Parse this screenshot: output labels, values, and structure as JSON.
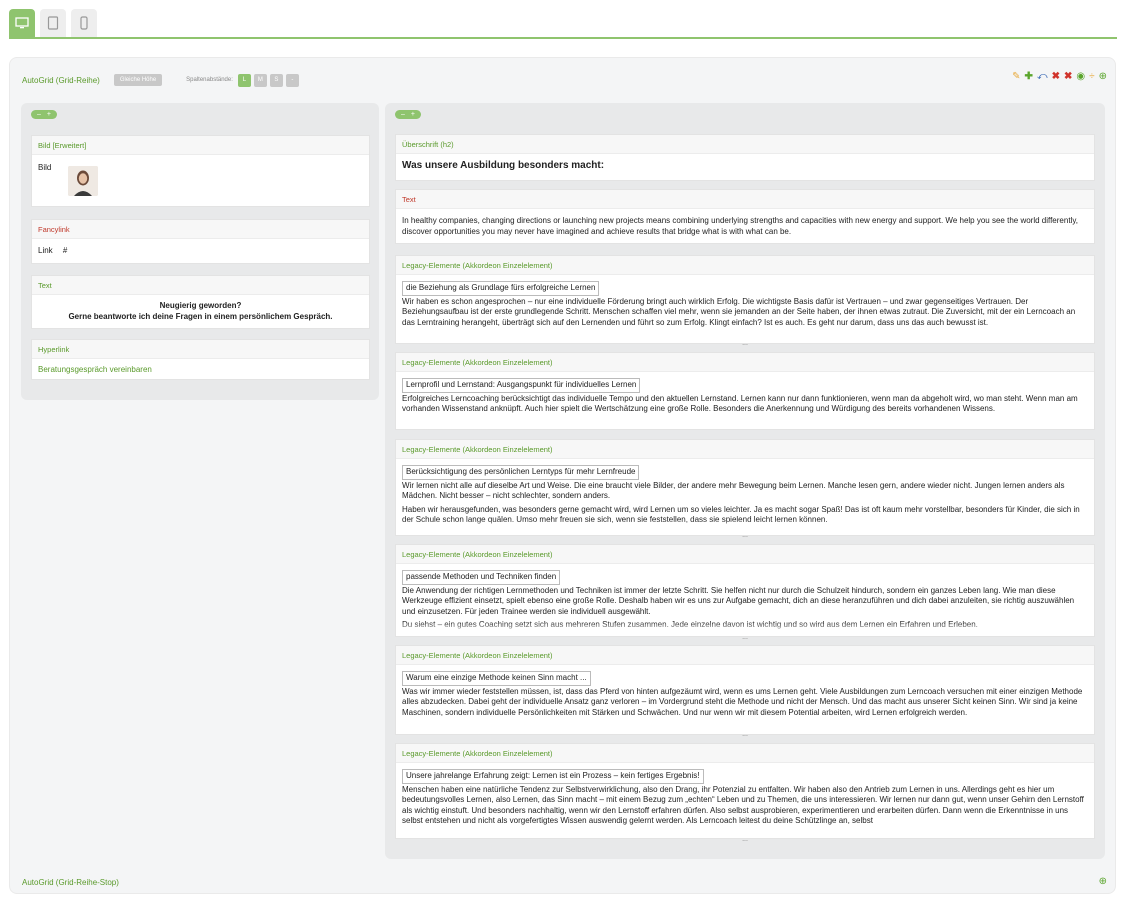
{
  "autogrid": {
    "title": "AutoGrid (Grid-Reihe)",
    "equal_height_label": "Gleiche Höhe",
    "spacing_label": "Spaltenabstände:",
    "spacing_options": [
      "L",
      "M",
      "S",
      "-"
    ],
    "footer_title": "AutoGrid (Grid-Reihe-Stop)"
  },
  "icons": {
    "desktop": "desktop-icon",
    "tablet": "tablet-icon",
    "phone": "phone-icon",
    "edit": "pencil-icon",
    "add": "plus-icon",
    "move": "move-icon",
    "delete": "x-icon",
    "delete_all": "x-icon",
    "view": "eye-icon",
    "split": "split-icon",
    "add_circle": "plus-circle-icon"
  },
  "colors": {
    "accent": "#8fc46e",
    "label_green": "#5a9a2b",
    "label_red": "#c0392b"
  },
  "left": {
    "image": {
      "title": "Bild [Erweitert]",
      "label": "Bild"
    },
    "fancylink": {
      "title": "Fancylink",
      "label": "Link",
      "value": "#"
    },
    "text": {
      "title": "Text",
      "line1": "Neugierig geworden?",
      "line2": "Gerne beantworte ich deine Fragen in einem persönlichem Gespräch."
    },
    "hyperlink": {
      "title": "Hyperlink",
      "link_text": "Beratungsgespräch vereinbaren"
    }
  },
  "right": {
    "heading": {
      "title": "Überschrift (h2)",
      "text": "Was unsere Ausbildung besonders macht:"
    },
    "text": {
      "title": "Text",
      "body": "In healthy companies, changing directions or launching new projects means combining underlying strengths and capacities with new energy and support. We help you see the world differently, discover opportunities you may never have imagined and achieve results that bridge what is with what can be."
    },
    "accordion_title": "Legacy-Elemente (Akkordeon Einzelelement)",
    "ellipsis": "...",
    "accordions": [
      {
        "heading": "die Beziehung als Grundlage fürs erfolgreiche Lernen",
        "body": "Wir haben es schon angesprochen – nur eine individuelle Förderung bringt auch wirklich Erfolg. Die wichtigste Basis dafür ist Vertrauen – und zwar gegenseitiges Vertrauen. Der Beziehungsaufbau ist der erste grundlegende Schritt. Menschen schaffen viel mehr, wenn sie jemanden an der Seite haben, der ihnen etwas zutraut. Die Zuversicht, mit der ein Lerncoach an das Lerntraining herangeht, überträgt sich auf den Lernenden und führt so zum Erfolg. Klingt einfach? Ist es auch. Es geht nur darum, dass uns das auch bewusst ist.",
        "body2": ""
      },
      {
        "heading": "Lernprofil und Lernstand: Ausgangspunkt für individuelles Lernen",
        "body": "Erfolgreiches Lerncoaching berücksichtigt das individuelle Tempo und den aktuellen Lernstand. Lernen kann nur dann funktionieren, wenn man da abgeholt wird, wo man steht. Wenn man am vorhanden Wissenstand anknüpft. Auch hier spielt die Wertschätzung eine große Rolle. Besonders die Anerkennung und Würdigung des bereits vorhandenen Wissens.",
        "body2": ""
      },
      {
        "heading": "Berücksichtigung des persönlichen Lerntyps für mehr Lernfreude",
        "body": "Wir lernen nicht alle auf dieselbe Art und Weise. Die eine braucht viele Bilder, der andere mehr Bewegung beim Lernen. Manche lesen gern, andere wieder nicht. Jungen lernen anders als Mädchen. Nicht besser – nicht schlechter, sondern anders.",
        "body2": "Haben wir herausgefunden, was besonders gerne gemacht wird, wird Lernen um so vieles leichter. Ja es macht sogar Spaß! Das ist oft kaum mehr vorstellbar, besonders für Kinder, die sich in der Schule schon lange quälen. Umso mehr freuen sie sich, wenn sie feststellen, dass sie spielend leicht lernen können."
      },
      {
        "heading": "passende Methoden und Techniken finden",
        "body": "Die Anwendung der richtigen Lernmethoden und Techniken ist immer der letzte Schritt. Sie helfen nicht nur durch die Schulzeit hindurch, sondern ein ganzes Leben lang. Wie man diese Werkzeuge effizient einsetzt, spielt ebenso eine große Rolle. Deshalb haben wir es uns zur Aufgabe gemacht, dich an diese heranzuführen und dich dabei anzuleiten, sie richtig auszuwählen und einzusetzen. Für jeden Trainee werden sie individuell ausgewählt.",
        "body2": "Du siehst – ein gutes Coaching setzt sich aus mehreren Stufen zusammen. Jede einzelne davon ist wichtig und so wird aus dem Lernen ein Erfahren und Erleben."
      },
      {
        "heading": "Warum eine einzige Methode keinen Sinn macht ...",
        "body": "Was wir immer wieder feststellen müssen, ist, dass das Pferd von hinten aufgezäumt wird, wenn es ums Lernen geht. Viele Ausbildungen zum Lerncoach versuchen mit einer einzigen Methode alles abzudecken. Dabei geht der individuelle Ansatz ganz verloren – im Vordergrund steht die Methode und nicht der Mensch. Und das macht aus unserer Sicht keinen Sinn. Wir sind ja keine Maschinen, sondern individuelle Persönlichkeiten mit Stärken und Schwächen. Und nur wenn wir mit diesem Potential arbeiten, wird Lernen erfolgreich werden.",
        "body2": ""
      },
      {
        "heading": "Unsere jahrelange Erfahrung zeigt: Lernen ist ein Prozess – kein fertiges Ergebnis!",
        "body": "Menschen haben eine natürliche Tendenz zur Selbstverwirklichung, also den Drang, ihr Potenzial zu entfalten. Wir haben also den Antrieb zum Lernen in uns. Allerdings geht es hier um bedeutungsvolles Lernen, also Lernen, das Sinn macht – mit einem Bezug zum „echten“ Leben und zu Themen, die uns interessieren. Wir lernen nur dann gut, wenn unser Gehirn den Lernstoff als wichtig einstuft. Und besonders nachhaltig, wenn wir den Lernstoff erfahren dürfen. Also selbst ausprobieren, experimentieren und erarbeiten dürfen. Dann wenn die Erkenntnisse in uns selbst entstehen und nicht als vorgefertigtes Wissen auswendig gelernt werden. Als Lerncoach leitest du deine Schützlinge an, selbst",
        "body2": ""
      }
    ]
  }
}
